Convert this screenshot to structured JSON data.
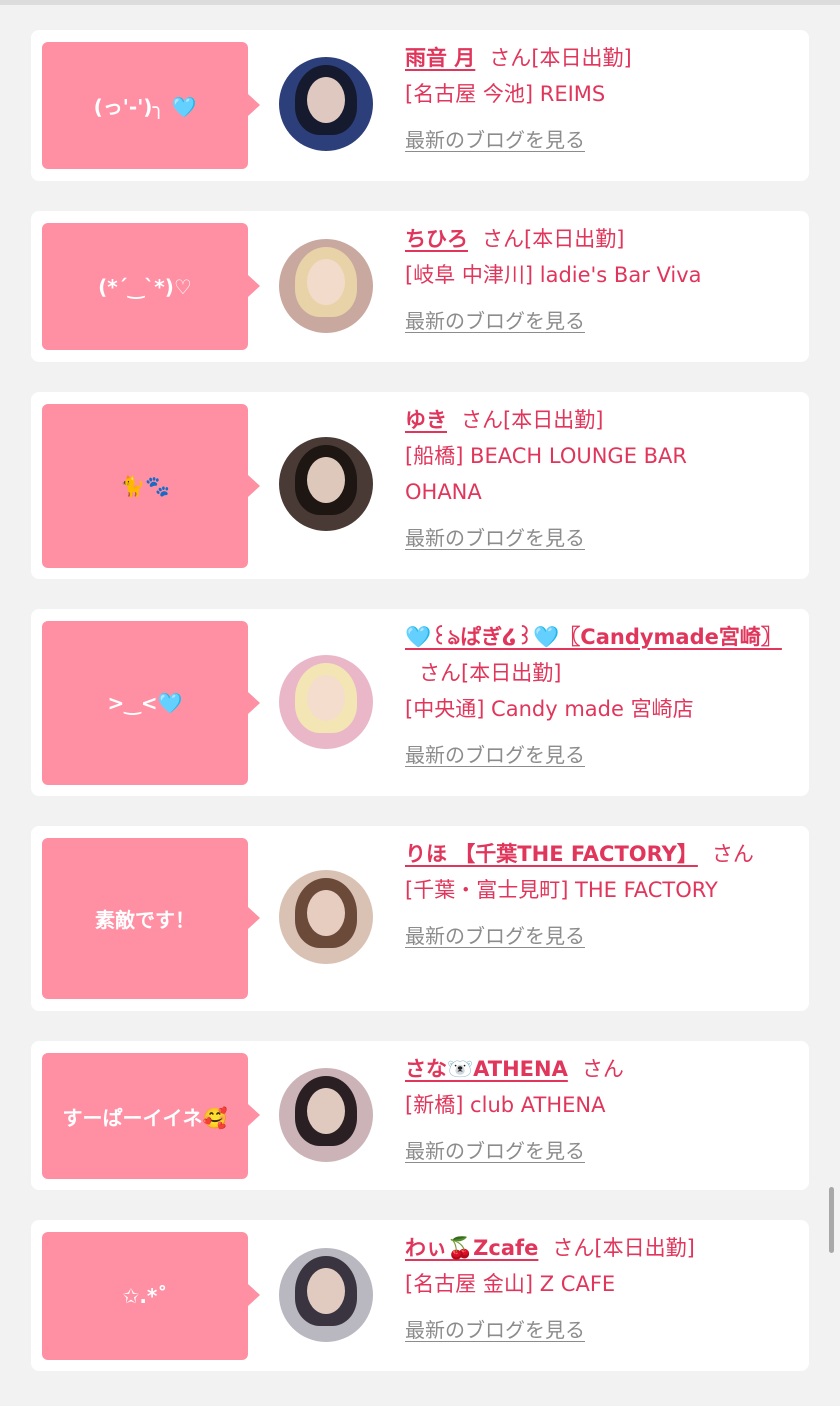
{
  "colors": {
    "accent": "#e0365b",
    "bubble": "#ff8fa3",
    "link_gray": "#8c8c8c",
    "background": "#f2f2f2",
    "card": "#ffffff"
  },
  "san_label": "さん",
  "blog_link_label": "最新のブログを見る",
  "cards": [
    {
      "comment": "(っ'-')╮ 🩵",
      "name": "雨音 月",
      "status": "[本日出勤]",
      "shop": "[名古屋 今池] REIMS",
      "avatar_icon": "girl-avatar-photo"
    },
    {
      "comment": "(*´‿`*)♡",
      "name": "ちひろ",
      "status": "[本日出勤]",
      "shop": "[岐阜 中津川] ladie's Bar Viva",
      "avatar_icon": "girl-avatar-photo"
    },
    {
      "comment": "🐈🐾",
      "name": "ゆき",
      "status": "[本日出勤]",
      "shop": "[船橋] BEACH LOUNGE BAR OHANA",
      "avatar_icon": "girl-avatar-photo"
    },
    {
      "comment": ">‿<🩵",
      "name": "🩵꒰ঌぱぎ໒꒱🩵〖Candymade宮崎〗",
      "status": "[本日出勤]",
      "shop": "[中央通] Candy made 宮崎店",
      "avatar_icon": "girl-avatar-photo"
    },
    {
      "comment": "素敵です！",
      "name": "りほ 【千葉THE FACTORY】",
      "status": "",
      "shop": "[千葉・富士見町] THE FACTORY",
      "avatar_icon": "girl-avatar-photo"
    },
    {
      "comment": "すーぱーイイネ🥰",
      "name": "さな🐻‍❄️ATHENA",
      "status": "",
      "shop": "[新橋] club ATHENA",
      "avatar_icon": "girl-avatar-photo"
    },
    {
      "comment": "✩.*˚",
      "name": "わぃ🍒Zcafe",
      "status": "[本日出勤]",
      "shop": "[名古屋 金山] Z CAFE",
      "avatar_icon": "girl-avatar-photo"
    }
  ]
}
